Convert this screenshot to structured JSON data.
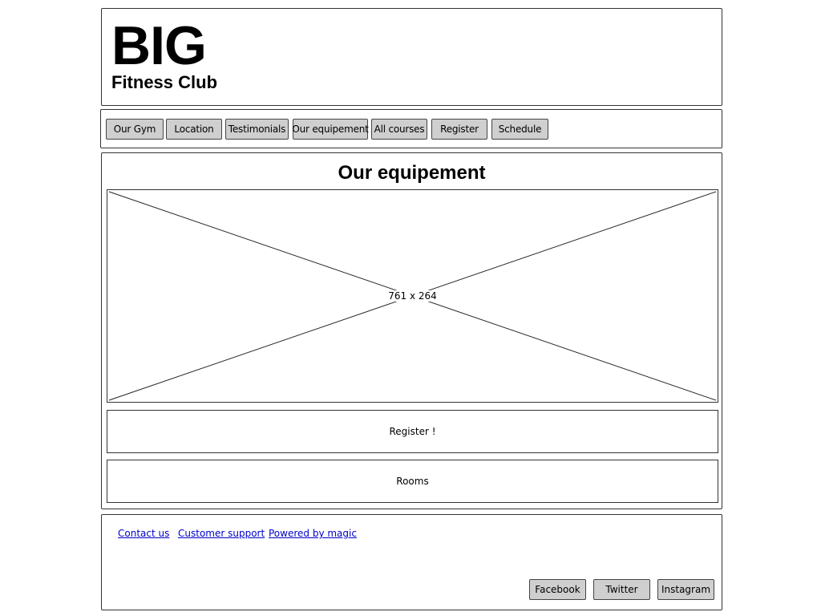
{
  "header": {
    "logo_main": "BIG",
    "logo_sub": "Fitness Club"
  },
  "nav": {
    "items": [
      {
        "label": "Our Gym"
      },
      {
        "label": "Location"
      },
      {
        "label": "Testimonials"
      },
      {
        "label": "Our equipement"
      },
      {
        "label": "All courses"
      },
      {
        "label": "Register"
      },
      {
        "label": "Schedule"
      }
    ]
  },
  "main": {
    "title": "Our equipement",
    "image_label": "761 x 264",
    "register_label": "Register !",
    "rooms_label": "Rooms"
  },
  "footer": {
    "links": [
      {
        "label": "Contact us"
      },
      {
        "label": "Customer support"
      },
      {
        "label": "Powered by magic"
      }
    ],
    "social": [
      {
        "label": "Facebook"
      },
      {
        "label": "Twitter"
      },
      {
        "label": "Instagram"
      }
    ]
  },
  "colors": {
    "button_bg": "#cfcfcf",
    "link": "#0000cc",
    "border": "#333333"
  }
}
